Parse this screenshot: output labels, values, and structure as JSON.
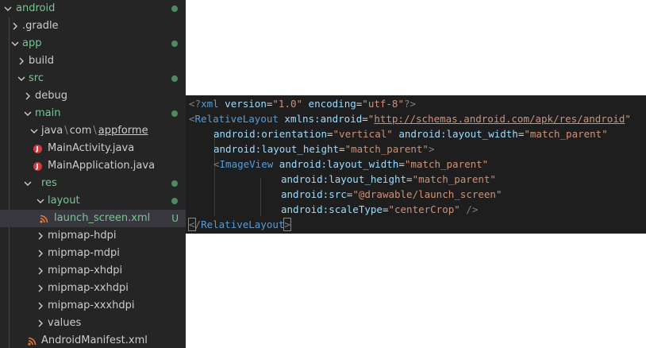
{
  "explorer": {
    "rows": [
      {
        "label": "android",
        "expanded": true,
        "green": true,
        "status": "dot"
      },
      {
        "label": ".gradle",
        "expanded": false,
        "green": false,
        "status": ""
      },
      {
        "label": "app",
        "expanded": true,
        "green": true,
        "status": "dot"
      },
      {
        "label": "build",
        "expanded": false,
        "green": false,
        "status": ""
      },
      {
        "label": "src",
        "expanded": true,
        "green": true,
        "status": "dot"
      },
      {
        "label": "debug",
        "expanded": false,
        "green": false,
        "status": ""
      },
      {
        "label": "main",
        "expanded": true,
        "green": true,
        "status": "dot"
      },
      {
        "label": "java",
        "sep1": "\\",
        "part2": "com",
        "sep2": "\\",
        "part3": "appforme",
        "expanded": true,
        "green": false,
        "status": ""
      },
      {
        "label": "MainActivity.java",
        "file": "java",
        "green": false,
        "status": ""
      },
      {
        "label": "MainApplication.java",
        "file": "java",
        "green": false,
        "status": ""
      },
      {
        "label": "res",
        "expanded": true,
        "green": true,
        "status": "dot"
      },
      {
        "label": "layout",
        "expanded": true,
        "green": true,
        "status": "dot"
      },
      {
        "label": "launch_screen.xml",
        "file": "xml",
        "green": true,
        "status": "U",
        "selected": true
      },
      {
        "label": "mipmap-hdpi",
        "expanded": false,
        "green": false,
        "status": ""
      },
      {
        "label": "mipmap-mdpi",
        "expanded": false,
        "green": false,
        "status": ""
      },
      {
        "label": "mipmap-xhdpi",
        "expanded": false,
        "green": false,
        "status": ""
      },
      {
        "label": "mipmap-xxhdpi",
        "expanded": false,
        "green": false,
        "status": ""
      },
      {
        "label": "mipmap-xxxhdpi",
        "expanded": false,
        "green": false,
        "status": ""
      },
      {
        "label": "values",
        "expanded": false,
        "green": false,
        "status": ""
      },
      {
        "label": "AndroidManifest.xml",
        "file": "xml",
        "green": false,
        "status": ""
      }
    ]
  },
  "code": {
    "line1": {
      "a": "<?",
      "b": "xml",
      "c": " version",
      "d": "=",
      "e": "\"1.0\"",
      "f": " encoding",
      "g": "=",
      "h": "\"utf-8\"",
      "i": "?>"
    },
    "line2": {
      "a": "<",
      "b": "RelativeLayout",
      "c": " xmlns:android",
      "d": "=",
      "e": "\"",
      "f": "http://schemas.android.com/apk/res/android",
      "g": "\""
    },
    "line3": {
      "a": "android:orientation",
      "b": "=",
      "c": "\"vertical\"",
      "d": " android:layout_width",
      "e": "=",
      "f": "\"match_parent\""
    },
    "line4": {
      "a": "android:layout_height",
      "b": "=",
      "c": "\"match_parent\"",
      "d": ">"
    },
    "line5": {
      "a": "<",
      "b": "ImageView",
      "c": " android:layout_width",
      "d": "=",
      "e": "\"match_parent\""
    },
    "line6": {
      "a": "android:layout_height",
      "b": "=",
      "c": "\"match_parent\""
    },
    "line7": {
      "a": "android:src",
      "b": "=",
      "c": "\"@drawable/launch_screen\""
    },
    "line8": {
      "a": "android:scaleType",
      "b": "=",
      "c": "\"centerCrop\"",
      "d": " />"
    },
    "line9": {
      "a": "<",
      "b": "/",
      "c": "RelativeLayout",
      "d": ">"
    }
  },
  "colors": {
    "tree_bg": "#252526",
    "editor_bg": "#1e1e1e",
    "git_green": "#73c991",
    "tag_blue": "#569cd6",
    "attr_lightblue": "#9cdcfe",
    "string_orange": "#ce9178"
  }
}
